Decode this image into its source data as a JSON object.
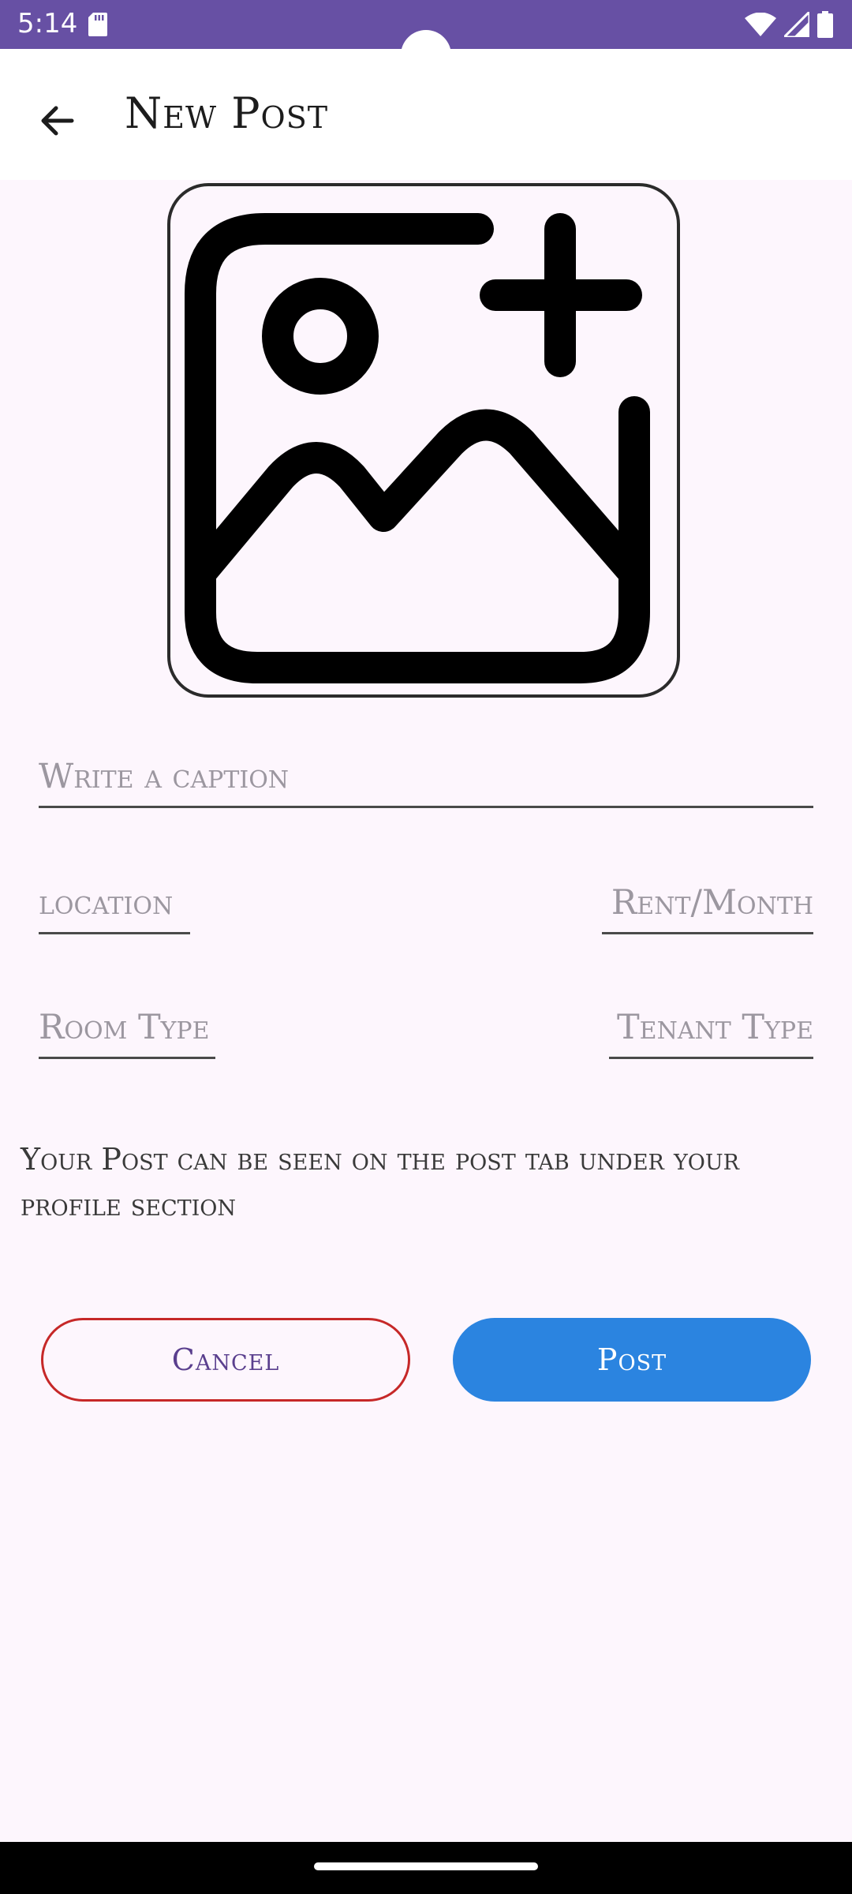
{
  "status_bar": {
    "time": "5:14",
    "icons": [
      "sd-card-icon",
      "wifi-icon",
      "signal-icon",
      "battery-icon"
    ],
    "color": "#6750A4"
  },
  "app_bar": {
    "title": "New Post",
    "back_icon": "arrow-back-icon"
  },
  "image_picker": {
    "icon": "add-photo-icon"
  },
  "form": {
    "caption_placeholder": "Write a caption",
    "location_placeholder": "location",
    "rent_placeholder": "Rent/Month",
    "room_type_placeholder": "Room Type",
    "tenant_type_placeholder": "Tenant Type"
  },
  "info": {
    "text": "Your Post can be seen on the post tab under your profile section"
  },
  "actions": {
    "cancel_label": "Cancel",
    "post_label": "Post",
    "cancel_color": "#C62828",
    "post_color": "#2B84E0"
  }
}
